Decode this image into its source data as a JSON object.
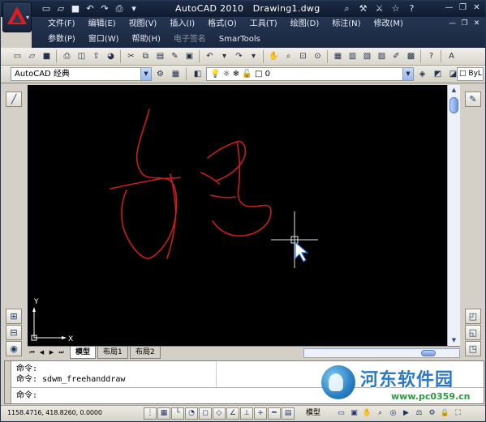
{
  "title": {
    "app": "AutoCAD 2010",
    "file": "Drawing1.dwg"
  },
  "menus": {
    "row1": [
      "文件(F)",
      "编辑(E)",
      "视图(V)",
      "插入(I)",
      "格式(O)",
      "工具(T)",
      "绘图(D)",
      "标注(N)",
      "修改(M)"
    ],
    "row2": [
      "参数(P)",
      "窗口(W)",
      "帮助(H)",
      "电子签名",
      "SmarTools"
    ]
  },
  "toolbar": {
    "workspace": "AutoCAD 经典",
    "layer_value": "0",
    "bylayer": "ByL"
  },
  "layout_tabs": [
    "模型",
    "布局1",
    "布局2"
  ],
  "ucs": {
    "x_label": "X",
    "y_label": "Y"
  },
  "command_line": {
    "line1": "命令: ",
    "line2": "命令: sdwm_freehanddraw",
    "prompt": "命令: "
  },
  "status": {
    "coordinates": "1158.4716, 418.8260, 0.0000",
    "model_label": "模型"
  },
  "watermark": {
    "text": "河东软件园",
    "url": "www.pc0359.cn"
  },
  "colors": {
    "sketch_stroke": "#c81e1e",
    "canvas_bg": "#000000",
    "title_bg": "#1a2740"
  }
}
